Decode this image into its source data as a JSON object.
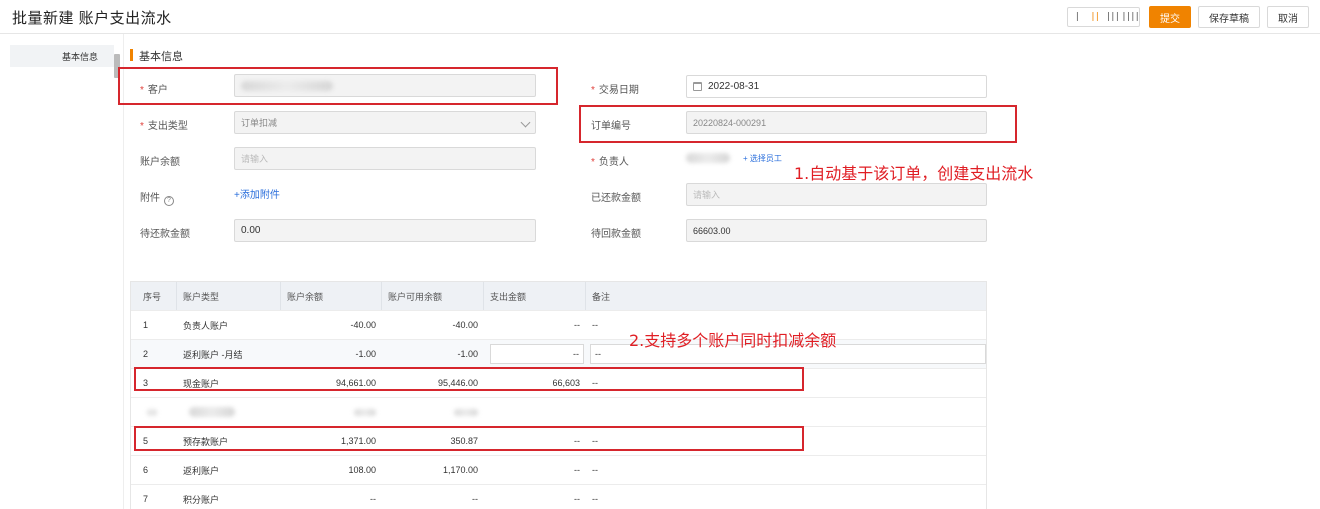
{
  "header": {
    "title": "批量新建 账户支出流水",
    "layout_options": [
      "|",
      "||",
      "|||",
      "||||"
    ],
    "submit_label": "提交",
    "save_draft_label": "保存草稿",
    "cancel_label": "取消"
  },
  "sidebar": {
    "items": [
      {
        "label": "基本信息"
      }
    ]
  },
  "section": {
    "title": "基本信息"
  },
  "form": {
    "required_mark": "*",
    "customer": {
      "label": "客户",
      "value": ""
    },
    "trade_date": {
      "label": "交易日期",
      "value": "2022-08-31"
    },
    "expense_type": {
      "label": "支出类型",
      "value": "订单扣减"
    },
    "order_no": {
      "label": "订单编号",
      "value": "20220824-000291"
    },
    "account_balance": {
      "label": "账户余额",
      "placeholder": "请输入"
    },
    "owner": {
      "label": "负责人",
      "select_label": "+ 选择员工"
    },
    "attachment": {
      "label": "附件",
      "help": "?",
      "add_label": "+添加附件"
    },
    "repaid_amount": {
      "label": "已还款金额",
      "placeholder": "请输入"
    },
    "pending_repay": {
      "label": "待还款金额",
      "value": "0.00"
    },
    "pending_receive": {
      "label": "待回款金额",
      "value": "66603.00"
    }
  },
  "annotations": {
    "note1": "1.自动基于该订单，创建支出流水",
    "note2": "2.支持多个账户同时扣减余额"
  },
  "table": {
    "columns": [
      "序号",
      "账户类型",
      "账户余额",
      "账户可用余额",
      "支出金额",
      "备注"
    ],
    "rows": [
      {
        "no": "1",
        "type": "负责人账户",
        "balance": "-40.00",
        "available": "-40.00",
        "expense": "--",
        "remark": "--"
      },
      {
        "no": "2",
        "type": "返利账户 -月结",
        "balance": "-1.00",
        "available": "-1.00",
        "expense": "--",
        "remark": "--"
      },
      {
        "no": "3",
        "type": "现金账户",
        "balance": "94,661.00",
        "available": "95,446.00",
        "expense": "66,603",
        "remark": "--"
      },
      {
        "no": "",
        "type": "",
        "balance": "",
        "available": "",
        "expense": "",
        "remark": ""
      },
      {
        "no": "5",
        "type": "预存款账户",
        "balance": "1,371.00",
        "available": "350.87",
        "expense": "--",
        "remark": "--"
      },
      {
        "no": "6",
        "type": "返利账户",
        "balance": "108.00",
        "available": "1,170.00",
        "expense": "--",
        "remark": "--"
      },
      {
        "no": "7",
        "type": "积分账户",
        "balance": "--",
        "available": "--",
        "expense": "--",
        "remark": "--"
      }
    ]
  }
}
